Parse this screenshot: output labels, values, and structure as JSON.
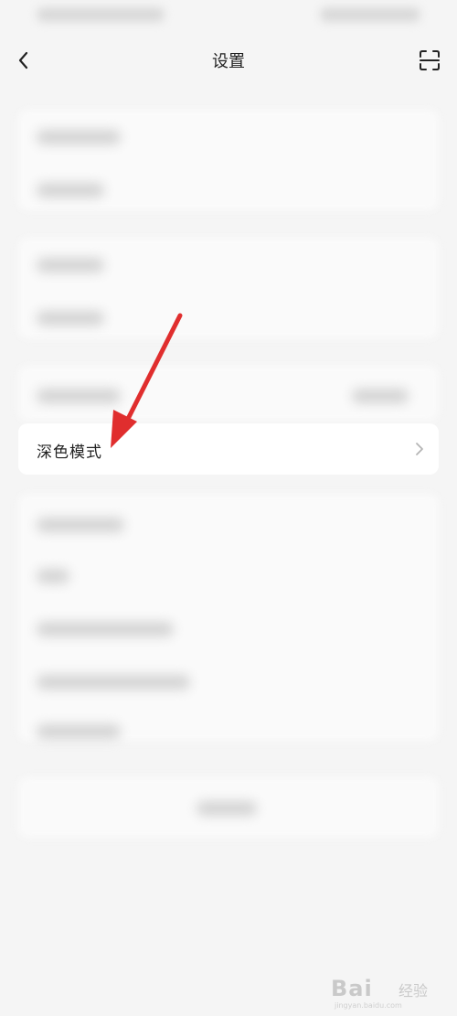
{
  "header": {
    "title": "设置",
    "back_icon": "chevron-left-icon",
    "scan_icon": "scan-icon"
  },
  "settings": {
    "dark_mode": {
      "label": "深色模式",
      "chevron_icon": "chevron-right-icon"
    }
  },
  "annotation": {
    "arrow_color": "#e02e2e"
  },
  "watermark": {
    "logo_text": "Bai",
    "sub_text": "经验",
    "url": "jingyan.baidu.com"
  },
  "colors": {
    "background": "#f5f5f5",
    "card": "#ffffff",
    "text": "#222222"
  }
}
